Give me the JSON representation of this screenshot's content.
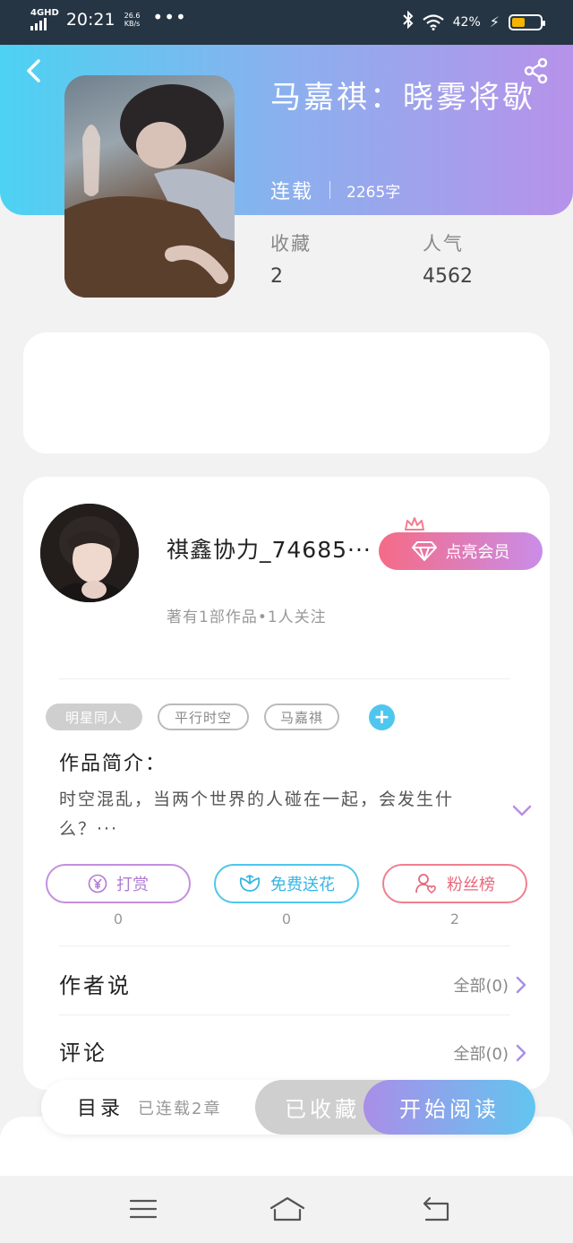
{
  "status_bar": {
    "network": "4GHD",
    "time": "20:21",
    "speed_value": "26.6",
    "speed_unit": "KB/s",
    "more": "•••",
    "battery_percent": "42%",
    "battery_level": 0.42,
    "battery_color": "#f5b400"
  },
  "header": {
    "back_icon": "back-arrow-icon",
    "share_icon": "share-icon",
    "gradient": [
      "#4cd2f2",
      "#8bb0ee",
      "#b792ea"
    ]
  },
  "book": {
    "title": "马嘉祺：晓雾将歇",
    "status": "连载",
    "word_count": "2265字",
    "stats": [
      {
        "label": "收藏",
        "value": "2"
      },
      {
        "label": "人气",
        "value": "4562"
      }
    ]
  },
  "author": {
    "name": "祺鑫协力_74685···",
    "subtitle": "著有1部作品•1人关注",
    "vip_button": "点亮会员",
    "vip_icon": "diamond-icon",
    "crown_icon": "crown-icon"
  },
  "tags": [
    "明星同人",
    "平行时空",
    "马嘉祺"
  ],
  "tag_add": "+",
  "intro": {
    "title": "作品简介：",
    "text": "时空混乱，当两个世界的人碰在一起，会发生什么？···"
  },
  "actions": [
    {
      "label": "打赏",
      "icon": "yuan-coin-icon",
      "count": "0"
    },
    {
      "label": "免费送花",
      "icon": "flower-icon",
      "count": "0"
    },
    {
      "label": "粉丝榜",
      "icon": "fans-icon",
      "count": "2"
    }
  ],
  "author_says": {
    "title": "作者说",
    "link": "全部(0)"
  },
  "comments": {
    "title": "评论",
    "link": "全部(0)"
  },
  "bottom": {
    "toc_label": "目录",
    "toc_count": "已连载2章",
    "collected_label": "已收藏",
    "read_label": "开始阅读"
  },
  "nav": [
    "menu-icon",
    "home-icon",
    "back-icon"
  ]
}
